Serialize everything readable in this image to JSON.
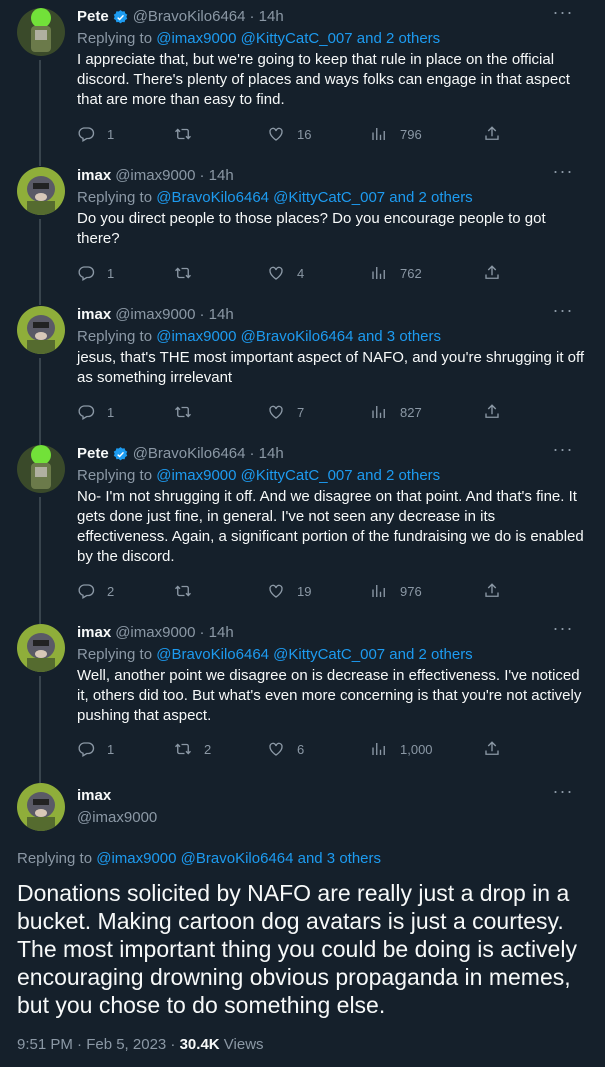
{
  "colors": {
    "background": "#15202b",
    "link": "#1d9bf0",
    "muted": "#8b98a5",
    "text": "#f7f9f9",
    "verified": "#1d9bf0"
  },
  "tweets": [
    {
      "name": "Pete",
      "verified": true,
      "handle": "@BravoKilo6464",
      "time": "· 14h",
      "reply_prefix": "Replying to ",
      "reply_links": "@imax9000 @KittyCatC_007 and 2 others",
      "text": "I appreciate that, but we're going to keep that rule in place on the official discord.  There's plenty of places and ways folks can engage in that aspect that are more than easy to find.",
      "replies": "1",
      "retweets": "",
      "likes": "16",
      "views": "796"
    },
    {
      "name": "imax",
      "verified": false,
      "handle": "@imax9000",
      "time": "· 14h",
      "reply_prefix": "Replying to ",
      "reply_links": "@BravoKilo6464 @KittyCatC_007 and 2 others",
      "text": "Do you direct people to those places? Do you encourage people to got there?",
      "replies": "1",
      "retweets": "",
      "likes": "4",
      "views": "762"
    },
    {
      "name": "imax",
      "verified": false,
      "handle": "@imax9000",
      "time": "· 14h",
      "reply_prefix": "Replying to ",
      "reply_links": "@imax9000 @BravoKilo6464 and 3 others",
      "text": "jesus, that's THE most important aspect of NAFO, and you're shrugging it off as something irrelevant",
      "replies": "1",
      "retweets": "",
      "likes": "7",
      "views": "827"
    },
    {
      "name": "Pete",
      "verified": true,
      "handle": "@BravoKilo6464",
      "time": "· 14h",
      "reply_prefix": "Replying to ",
      "reply_links": "@imax9000 @KittyCatC_007 and 2 others",
      "text": "No- I'm not shrugging it off. And we disagree on that point.  And that's fine.  It gets done just fine, in general.  I've not seen any decrease in its effectiveness.  Again, a significant portion of the fundraising we do is enabled by the discord.",
      "replies": "2",
      "retweets": "",
      "likes": "19",
      "views": "976"
    },
    {
      "name": "imax",
      "verified": false,
      "handle": "@imax9000",
      "time": "· 14h",
      "reply_prefix": "Replying to ",
      "reply_links": "@BravoKilo6464 @KittyCatC_007 and 2 others",
      "text": "Well, another point we disagree on is decrease in effectiveness. I've noticed it, others did too. But what's even more concerning is that you're not actively pushing that aspect.",
      "replies": "1",
      "retweets": "2",
      "likes": "6",
      "views": "1,000"
    }
  ],
  "main_tweet": {
    "name": "imax",
    "handle": "@imax9000",
    "reply_prefix": "Replying to ",
    "reply_links": "@imax9000 @BravoKilo6464 and 3 others",
    "text": "Donations solicited by NAFO are really just a drop in a bucket. Making cartoon dog avatars is just a courtesy. The most important thing you could be doing is actively encouraging drowning obvious propaganda in memes, but you chose to do something else.",
    "time": "9:51 PM · Feb 5, 2023 · ",
    "views_count": "30.4K",
    "views_label": " Views"
  }
}
